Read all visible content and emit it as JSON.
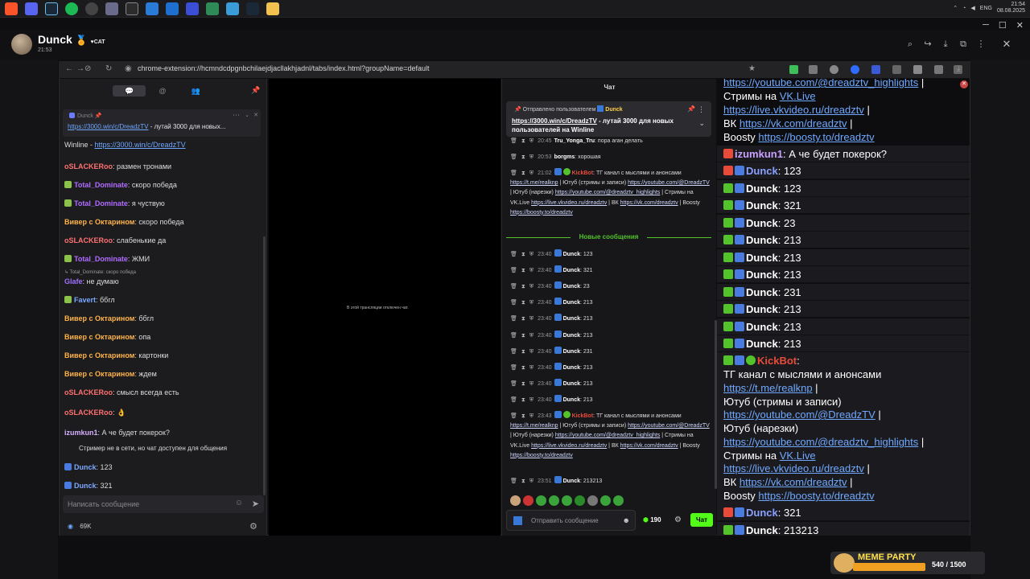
{
  "system": {
    "clock_time": "21:54",
    "clock_date": "08.08.2025",
    "lang": "ENG"
  },
  "telegram": {
    "name": "Dunck",
    "status_badge": "CAT",
    "time": "21:53"
  },
  "browser": {
    "url": "chrome-extension://hcmndcdpgnbchilaejdjacllakhjadnl/tabs/index.html?groupName=default"
  },
  "panel_a": {
    "pinned_user": "Dunck",
    "pinned_link": "https://3000.win/c/DreadzTV",
    "pinned_text": " - лутай 3000 для новых...",
    "winline_text": "Winline - ",
    "winline_link": "https://3000.win/c/DreadzTV",
    "messages": [
      {
        "user": "oSLACKERoo",
        "text": "размен тронами",
        "color": "#ff7070"
      },
      {
        "user": "Total_Dominate",
        "text": "скоро победа",
        "color": "#b06cff"
      },
      {
        "user": "Total_Dominate",
        "text": "я чуствую",
        "color": "#b06cff"
      },
      {
        "user": "Вивер с Октарином",
        "text": "скоро победа",
        "color": "#ffb347"
      },
      {
        "user": "oSLACKERoo",
        "text": "слабенькие да",
        "color": "#ff7070"
      },
      {
        "user": "Total_Dominate",
        "text": "ЖМИ",
        "color": "#b06cff"
      },
      {
        "user": "Glafe",
        "text": "не думаю",
        "color": "#a070ff"
      },
      {
        "user": "Favert",
        "text": "ббгл",
        "color": "#7aa8ff"
      },
      {
        "user": "Вивер с Октарином",
        "text": "ббгл",
        "color": "#ffb347"
      },
      {
        "user": "Вивер с Октарином",
        "text": "опа",
        "color": "#ffb347"
      },
      {
        "user": "Вивер с Октарином",
        "text": "картонки",
        "color": "#ffb347"
      },
      {
        "user": "Вивер с Октарином",
        "text": "ждем",
        "color": "#ffb347"
      },
      {
        "user": "oSLACKERoo",
        "text": "смысл всегда есть",
        "color": "#ff7070"
      },
      {
        "user": "oSLACKERoo",
        "text": "👌",
        "color": "#ff7070"
      },
      {
        "user": "izumkun1",
        "text": "А че будет покерок?",
        "color": "#d6b0ff"
      }
    ],
    "reply_to": "Total_Dominate: скоро победа",
    "offline_note": "Стример не в сети, но чат доступен для общения",
    "tail": [
      {
        "user": "Dunck",
        "text": "123"
      },
      {
        "user": "Dunck",
        "text": "321"
      }
    ],
    "input_placeholder": "Написать сообщение",
    "viewers": "69K"
  },
  "panel_b": {
    "note": "В этой трансляции отключен чат."
  },
  "panel_c": {
    "title": "Чат",
    "pinned_header": "Отправлено пользователем",
    "pinned_user": "Dunck",
    "pinned_link": "https://3000.win/c/DreadzTV",
    "pinned_text": " - лутай 3000 для новых пользователей на Winline",
    "old": [
      {
        "time": "20:45",
        "user": "Tru_Yonga_Tru",
        "text": "пора аган делать"
      },
      {
        "time": "20:53",
        "user": "borgms",
        "text": "хорошая"
      }
    ],
    "kick_time_1": "21:02",
    "kick_time_2": "23:43",
    "new_label": "Новые сообщения",
    "new": [
      {
        "time": "23:40",
        "text": "123"
      },
      {
        "time": "23:40",
        "text": "321"
      },
      {
        "time": "23:40",
        "text": "23"
      },
      {
        "time": "23:40",
        "text": "213"
      },
      {
        "time": "23:40",
        "text": "213"
      },
      {
        "time": "23:40",
        "text": "213"
      },
      {
        "time": "23:40",
        "text": "231"
      },
      {
        "time": "23:40",
        "text": "213"
      },
      {
        "time": "23:40",
        "text": "213"
      },
      {
        "time": "23:40",
        "text": "213"
      }
    ],
    "last_time": "23:51",
    "last_text": "213213",
    "input_placeholder": "Отправить сообщение",
    "points": "190",
    "send_label": "Чат"
  },
  "kickbot": {
    "user": "KickBot",
    "line1": "ТГ канал с мыслями и анонсами",
    "tg": "https://t.me/realknp",
    "yt_label": "Ютуб (стримы и записи)",
    "yt": "https://youtube.com/@DreadzTV",
    "yth_label": "Ютуб (нарезки)",
    "yth": "https://youtube.com/@dreadztv_highlights",
    "vk_label": "Стримы на",
    "vk_link_text": "VK.Live",
    "vklive": "https://live.vkvideo.ru/dreadztv",
    "vk2_label": "ВК",
    "vk": "https://vk.com/dreadztv",
    "boosty_label": "Boosty",
    "boosty": "https://boosty.to/dreadztv",
    "sep": " | "
  },
  "panel_d": {
    "top": {
      "yth": "https://youtube.com/@dreadztv_highlights",
      "vk_label": "Стримы на",
      "vk_link_text": "VK.Live",
      "vklive": "https://live.vkvideo.ru/dreadztv",
      "vk2_label": "ВК",
      "vk": "https://vk.com/dreadztv",
      "boosty_label": "Boosty",
      "boosty": "https://boosty.to/dreadztv"
    },
    "izumkun": {
      "user": "izumkun1",
      "text": "А че будет покерок?"
    },
    "dunck_lines": [
      "123",
      "123",
      "321",
      "23",
      "213",
      "213",
      "213",
      "231",
      "213",
      "213",
      "213"
    ],
    "after": [
      {
        "text": "321"
      },
      {
        "text": "213213"
      }
    ],
    "user": "Dunck"
  },
  "meme": {
    "title": "MEME PARTY",
    "progress": "540 / 1500",
    "fraction": 0.36
  }
}
